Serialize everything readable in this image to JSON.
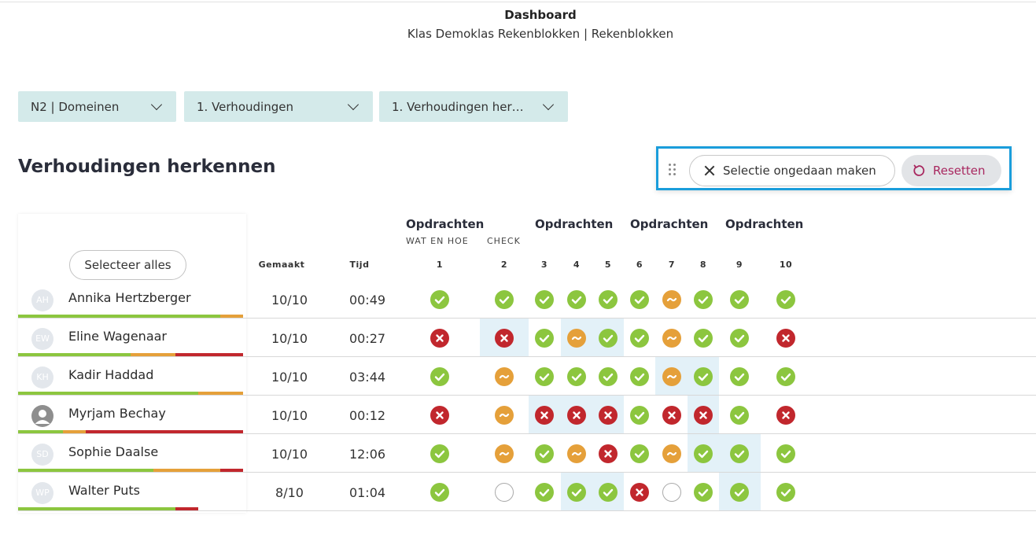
{
  "header": {
    "title": "Dashboard",
    "subtitle": "Klas Demoklas Rekenblokken | Rekenblokken"
  },
  "filters": [
    {
      "label": "N2 | Domeinen"
    },
    {
      "label": "1. Verhoudingen"
    },
    {
      "label": "1. Verhoudingen her…"
    }
  ],
  "page_title": "Verhoudingen herkennen",
  "actions": {
    "undo_label": "Selectie ongedaan maken",
    "reset_label": "Resetten"
  },
  "table": {
    "select_all_label": "Selecteer alles",
    "col_made": "Gemaakt",
    "col_time": "Tijd",
    "groups": [
      {
        "title": "Opdrachten",
        "subtitle_left": "WAT EN HOE",
        "subtitle_right": "CHECK"
      },
      {
        "title": "Opdrachten"
      },
      {
        "title": "Opdrachten"
      },
      {
        "title": "Opdrachten"
      }
    ],
    "questions": [
      "1",
      "2",
      "3",
      "4",
      "5",
      "6",
      "7",
      "8",
      "9",
      "10"
    ],
    "students": [
      {
        "initials": "AH",
        "avatar_type": "initials",
        "name": "Annika Hertzberger",
        "made": "10/10",
        "time": "00:49",
        "results": [
          "ok",
          "ok",
          "ok",
          "ok",
          "ok",
          "ok",
          "partial",
          "ok",
          "ok",
          "ok"
        ],
        "progress": {
          "green": 0.9,
          "orange": 0.1,
          "red": 0.0
        }
      },
      {
        "initials": "EW",
        "avatar_type": "initials",
        "name": "Eline Wagenaar",
        "made": "10/10",
        "time": "00:27",
        "results": [
          "wrong",
          "wrong",
          "ok",
          "partial",
          "ok",
          "ok",
          "partial",
          "ok",
          "ok",
          "wrong"
        ],
        "progress": {
          "green": 0.5,
          "orange": 0.2,
          "red": 0.3
        }
      },
      {
        "initials": "KH",
        "avatar_type": "initials",
        "name": "Kadir Haddad",
        "made": "10/10",
        "time": "03:44",
        "results": [
          "ok",
          "partial",
          "ok",
          "ok",
          "ok",
          "ok",
          "partial",
          "ok",
          "ok",
          "ok"
        ],
        "progress": {
          "green": 0.8,
          "orange": 0.2,
          "red": 0.0
        }
      },
      {
        "initials": "",
        "avatar_type": "person-icon",
        "name": "Myrjam Bechay",
        "made": "10/10",
        "time": "00:12",
        "results": [
          "wrong",
          "partial",
          "wrong",
          "wrong",
          "wrong",
          "ok",
          "wrong",
          "wrong",
          "ok",
          "wrong"
        ],
        "progress": {
          "green": 0.2,
          "orange": 0.1,
          "red": 0.7
        }
      },
      {
        "initials": "SD",
        "avatar_type": "initials",
        "name": "Sophie Daalse",
        "made": "10/10",
        "time": "12:06",
        "results": [
          "ok",
          "partial",
          "ok",
          "partial",
          "wrong",
          "ok",
          "partial",
          "ok",
          "ok",
          "ok"
        ],
        "progress": {
          "green": 0.6,
          "orange": 0.3,
          "red": 0.1
        }
      },
      {
        "initials": "WP",
        "avatar_type": "initials",
        "name": "Walter Puts",
        "made": "8/10",
        "time": "01:04",
        "results": [
          "ok",
          "empty",
          "ok",
          "ok",
          "ok",
          "wrong",
          "empty",
          "ok",
          "ok",
          "ok"
        ],
        "progress": {
          "green": 0.7,
          "orange": 0.0,
          "red": 0.1
        }
      }
    ],
    "highlighted_cells": [
      [
        1,
        1
      ],
      [
        1,
        3
      ],
      [
        1,
        4
      ],
      [
        2,
        6
      ],
      [
        2,
        7
      ],
      [
        3,
        2
      ],
      [
        3,
        3
      ],
      [
        3,
        4
      ],
      [
        3,
        7
      ],
      [
        4,
        7
      ],
      [
        4,
        8
      ],
      [
        5,
        3
      ],
      [
        5,
        4
      ],
      [
        5,
        8
      ]
    ]
  },
  "colors": {
    "ok": "#8cc63f",
    "partial": "#e5a03a",
    "wrong": "#c1272d",
    "filter_bg": "#d4eaea",
    "accent_border": "#1a9ddb",
    "reset_text": "#a8275f",
    "highlight": "#e3f1f8"
  }
}
